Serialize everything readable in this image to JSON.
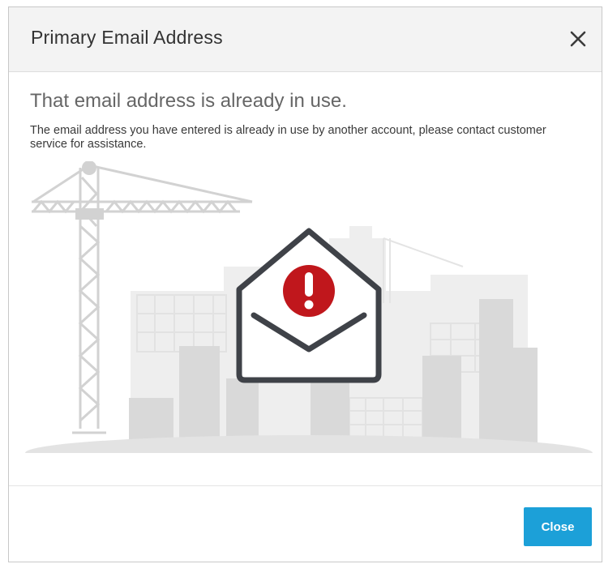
{
  "dialog": {
    "title": "Primary Email Address",
    "close_icon": "close-x-icon",
    "headline": "That email address is already in use.",
    "message": "The email address you have entered is already in use by another account, please contact customer service for assistance.",
    "illustration": {
      "icon": "envelope-alert-icon",
      "alert_glyph": "!",
      "alert_color": "#c0171c",
      "envelope_color": "#3f4248",
      "scene_color": "#e6e6e6"
    },
    "close_button_label": "Close",
    "accent_color": "#1ca0d8"
  }
}
